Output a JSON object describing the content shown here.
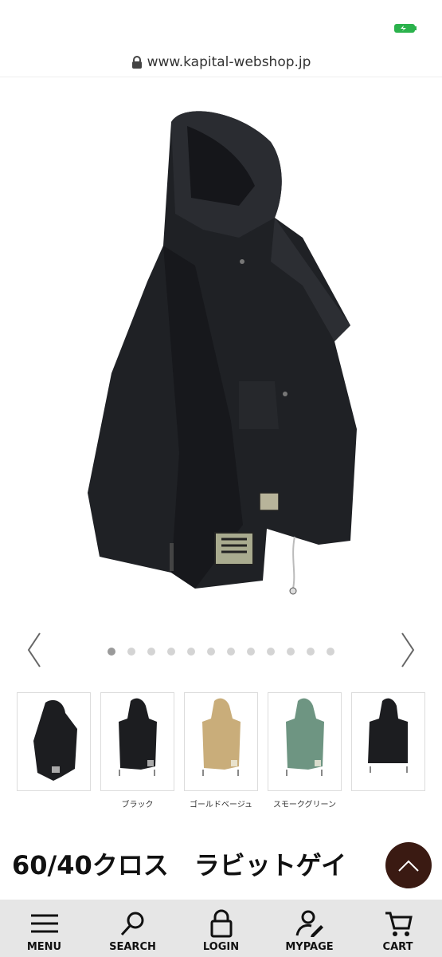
{
  "browser": {
    "url": "www.kapital-webshop.jp"
  },
  "status": {
    "battery_color": "#2bb24c"
  },
  "gallery": {
    "dot_count": 12,
    "active_index": 0
  },
  "variants": [
    {
      "caption": "",
      "color": "#1c1d20"
    },
    {
      "caption": "ブラック",
      "color": "#1c1d20"
    },
    {
      "caption": "ゴールドベージュ",
      "color": "#c9ad7a"
    },
    {
      "caption": "スモークグリーン",
      "color": "#6e9582"
    },
    {
      "caption": "",
      "color": "#1c1d20"
    }
  ],
  "product": {
    "title": "60/40クロス　ラビットゲイ"
  },
  "nav": {
    "menu": "MENU",
    "search": "SEARCH",
    "login": "LOGIN",
    "mypage": "MYPAGE",
    "cart": "CART"
  }
}
